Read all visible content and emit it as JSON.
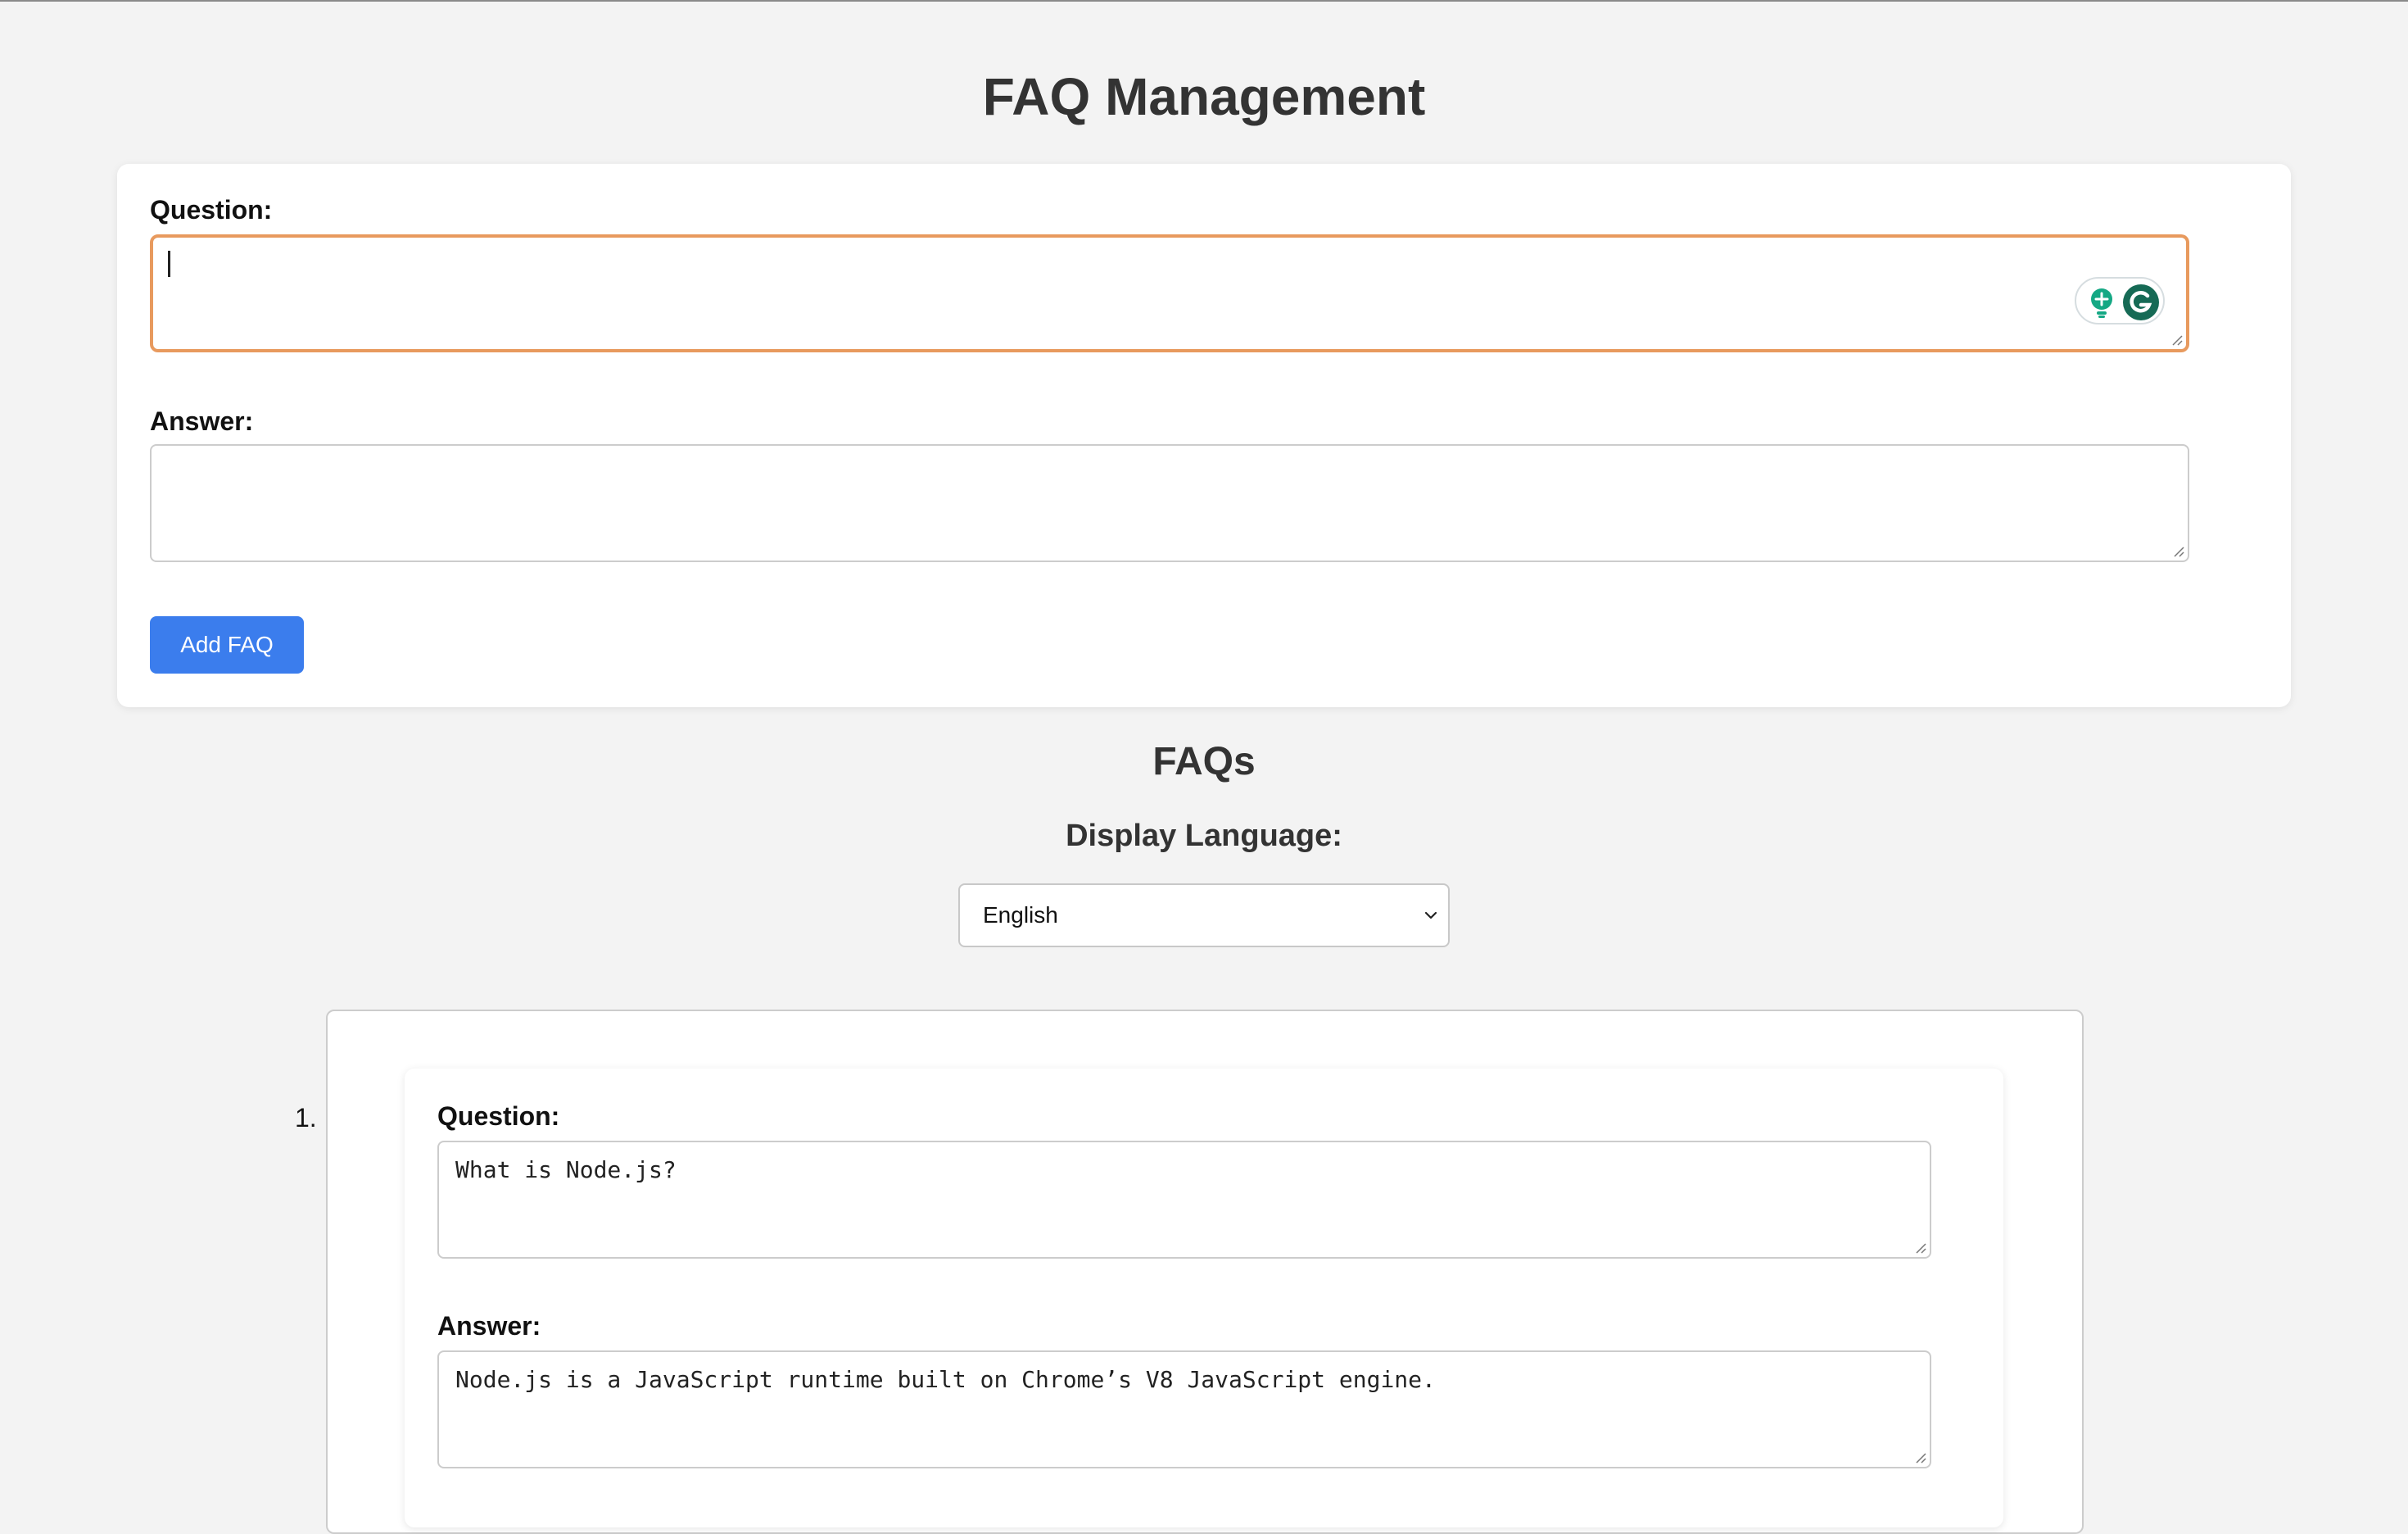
{
  "header": {
    "title": "FAQ Management"
  },
  "form": {
    "question_label": "Question:",
    "question_value": "",
    "answer_label": "Answer:",
    "answer_value": "",
    "add_button_label": "Add FAQ"
  },
  "faqs": {
    "title": "FAQs",
    "language_label": "Display Language:",
    "language_selected": "English",
    "items": [
      {
        "number": "1.",
        "question_label": "Question:",
        "question_value": "What is Node.js?",
        "answer_label": "Answer:",
        "answer_value": "Node.js is a JavaScript runtime built on Chrome’s V8 JavaScript engine."
      }
    ]
  },
  "colors": {
    "accent": "#3b7ded",
    "focus_border": "#e89a5e",
    "background": "#f3f3f3",
    "grammarly_green": "#15c39a"
  },
  "icons": {
    "grammarly_assist": "lightbulb-icon",
    "grammarly_logo": "grammarly-g-icon",
    "select_arrow": "chevron-down-icon"
  }
}
